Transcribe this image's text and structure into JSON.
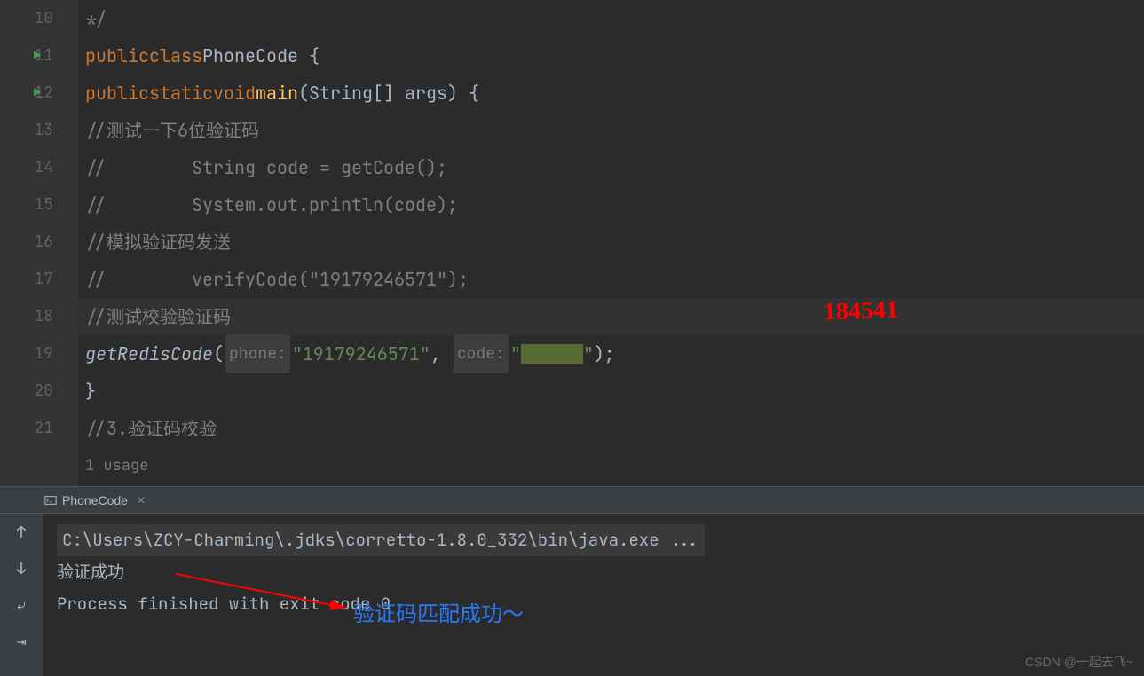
{
  "gutter": {
    "lines": [
      "10",
      "11",
      "12",
      "13",
      "14",
      "15",
      "16",
      "17",
      "18",
      "19",
      "20",
      "21",
      ""
    ]
  },
  "code": {
    "l10_comment": "*/",
    "l11": {
      "kw1": "public",
      "kw2": "class",
      "name": "PhoneCode",
      "brace": " {"
    },
    "l12": {
      "kw1": "public",
      "kw2": "static",
      "kw3": "void",
      "method": "main",
      "params": "(String[] args) {"
    },
    "l13_comment": "//测试一下6位验证码",
    "l14": {
      "comment": "//",
      "text": "        String code = getCode();"
    },
    "l15": {
      "comment": "//",
      "text": "        System.out.println(code);"
    },
    "l16_comment": "//模拟验证码发送",
    "l17": {
      "comment": "//",
      "method": "        verifyCode(",
      "str": "\"19179246571\"",
      "end": ");"
    },
    "l18_comment": "//测试校验验证码",
    "l19": {
      "method": "getRedisCode",
      "open": "(",
      "hint1": "phone:",
      "str1": "\"19179246571\"",
      "comma": ", ",
      "hint2": "code:",
      "quote": "\"",
      "end": ");"
    },
    "l20_brace": "}",
    "l21_comment": "//3.验证码校验",
    "usage": "1 usage"
  },
  "handwritten": "184541",
  "terminal": {
    "tab_name": "PhoneCode",
    "cmd": "C:\\Users\\ZCY-Charming\\.jdks\\corretto-1.8.0_332\\bin\\java.exe ...",
    "out1": "验证成功",
    "out_blank": "",
    "out2": "Process finished with exit code 0",
    "annotation": "验证码匹配成功～"
  },
  "watermark": "CSDN @一起去飞~"
}
